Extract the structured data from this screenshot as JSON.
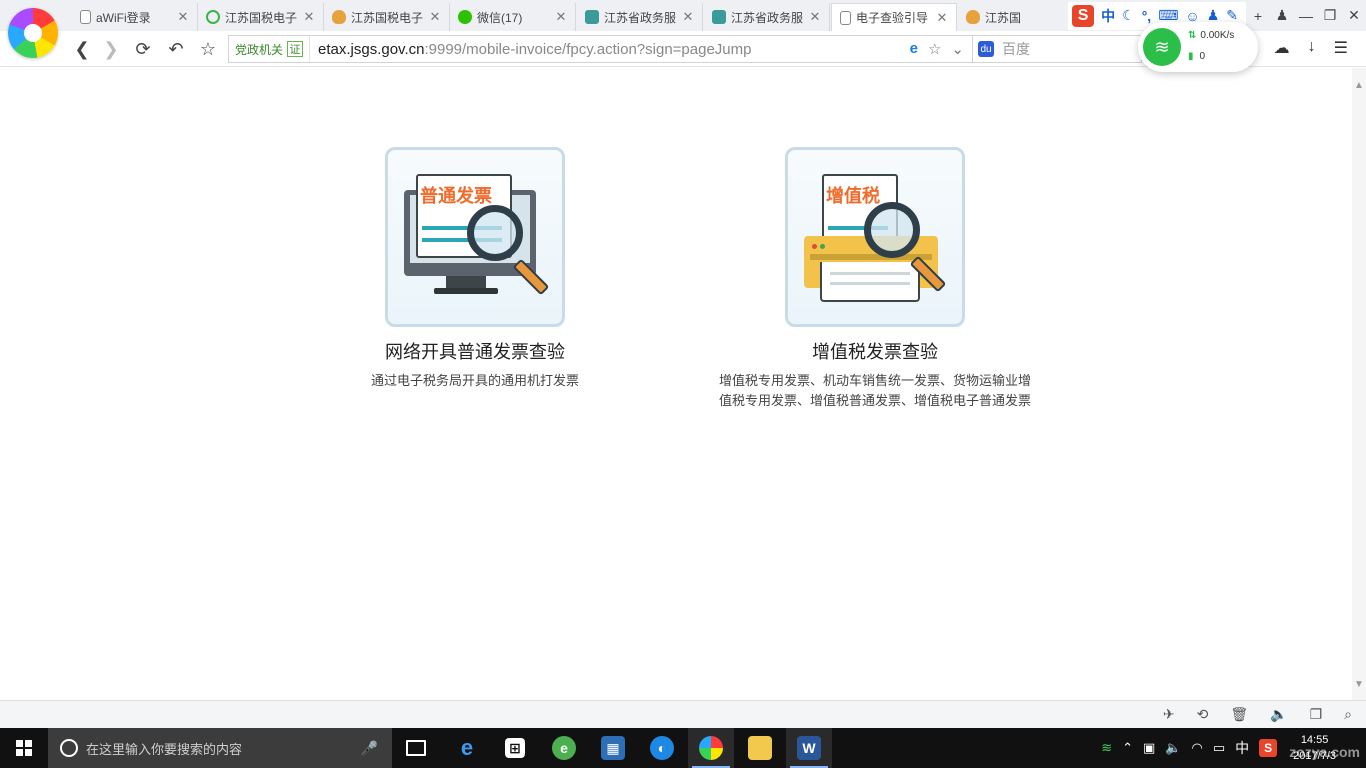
{
  "browser": {
    "tabs": [
      {
        "label": "aWiFi登录",
        "icon": "page-icon"
      },
      {
        "label": "江苏国税电子",
        "icon": "ring-icon"
      },
      {
        "label": "江苏国税电子",
        "icon": "shield-icon"
      },
      {
        "label": "微信(17)",
        "icon": "wechat-icon"
      },
      {
        "label": "江苏省政务服",
        "icon": "gov-icon"
      },
      {
        "label": "江苏省政务服",
        "icon": "gov-icon"
      },
      {
        "label": "电子查验引导",
        "icon": "page-icon"
      },
      {
        "label": "江苏国",
        "icon": "shield-icon"
      }
    ],
    "active_tab_index": 6,
    "ime_toolbar": {
      "logo": "S",
      "mode": "中"
    },
    "address": {
      "gov_badge": "党政机关",
      "gov_mark": "证",
      "host": "etax.jsgs.gov.cn",
      "rest": ":9999/mobile-invoice/fpcy.action?sign=pageJump"
    },
    "search": {
      "placeholder": "百度",
      "engine_mark": "du"
    },
    "wifi": {
      "speed": "0.00K/s",
      "count": "0"
    }
  },
  "main": {
    "cards": [
      {
        "icon_title": "普通发票",
        "title": "网络开具普通发票查验",
        "description": "通过电子税务局开具的通用机打发票"
      },
      {
        "icon_title": "增值税",
        "title": "增值税发票查验",
        "description_lines": [
          "增值税专用发票、机动车销售统一发票、货物运输业增",
          "值税专用发票、增值税普通发票、增值税电子普通发票"
        ]
      }
    ]
  },
  "taskbar": {
    "search_placeholder": "在这里输入你要搜索的内容",
    "apps": [
      "task-view",
      "edge",
      "store",
      "360-browser",
      "film",
      "search-app",
      "360-speed-browser",
      "file-explorer",
      "word"
    ],
    "tray": {
      "ime": "中",
      "time": "14:55",
      "date": "2017/7/3"
    },
    "watermark": "zozya.com"
  }
}
